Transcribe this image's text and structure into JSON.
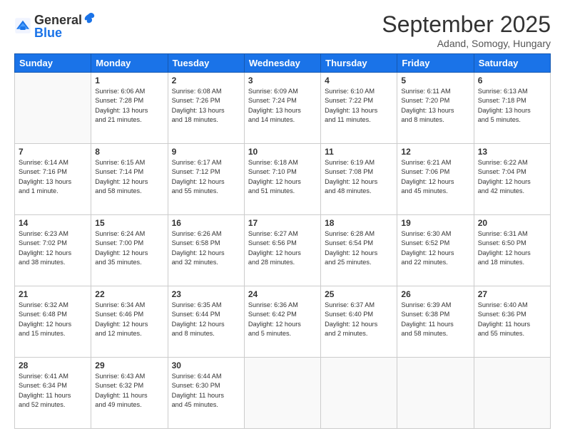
{
  "logo": {
    "general": "General",
    "blue": "Blue"
  },
  "header": {
    "month": "September 2025",
    "location": "Adand, Somogy, Hungary"
  },
  "days_of_week": [
    "Sunday",
    "Monday",
    "Tuesday",
    "Wednesday",
    "Thursday",
    "Friday",
    "Saturday"
  ],
  "weeks": [
    [
      {
        "day": "",
        "info": ""
      },
      {
        "day": "1",
        "info": "Sunrise: 6:06 AM\nSunset: 7:28 PM\nDaylight: 13 hours\nand 21 minutes."
      },
      {
        "day": "2",
        "info": "Sunrise: 6:08 AM\nSunset: 7:26 PM\nDaylight: 13 hours\nand 18 minutes."
      },
      {
        "day": "3",
        "info": "Sunrise: 6:09 AM\nSunset: 7:24 PM\nDaylight: 13 hours\nand 14 minutes."
      },
      {
        "day": "4",
        "info": "Sunrise: 6:10 AM\nSunset: 7:22 PM\nDaylight: 13 hours\nand 11 minutes."
      },
      {
        "day": "5",
        "info": "Sunrise: 6:11 AM\nSunset: 7:20 PM\nDaylight: 13 hours\nand 8 minutes."
      },
      {
        "day": "6",
        "info": "Sunrise: 6:13 AM\nSunset: 7:18 PM\nDaylight: 13 hours\nand 5 minutes."
      }
    ],
    [
      {
        "day": "7",
        "info": "Sunrise: 6:14 AM\nSunset: 7:16 PM\nDaylight: 13 hours\nand 1 minute."
      },
      {
        "day": "8",
        "info": "Sunrise: 6:15 AM\nSunset: 7:14 PM\nDaylight: 12 hours\nand 58 minutes."
      },
      {
        "day": "9",
        "info": "Sunrise: 6:17 AM\nSunset: 7:12 PM\nDaylight: 12 hours\nand 55 minutes."
      },
      {
        "day": "10",
        "info": "Sunrise: 6:18 AM\nSunset: 7:10 PM\nDaylight: 12 hours\nand 51 minutes."
      },
      {
        "day": "11",
        "info": "Sunrise: 6:19 AM\nSunset: 7:08 PM\nDaylight: 12 hours\nand 48 minutes."
      },
      {
        "day": "12",
        "info": "Sunrise: 6:21 AM\nSunset: 7:06 PM\nDaylight: 12 hours\nand 45 minutes."
      },
      {
        "day": "13",
        "info": "Sunrise: 6:22 AM\nSunset: 7:04 PM\nDaylight: 12 hours\nand 42 minutes."
      }
    ],
    [
      {
        "day": "14",
        "info": "Sunrise: 6:23 AM\nSunset: 7:02 PM\nDaylight: 12 hours\nand 38 minutes."
      },
      {
        "day": "15",
        "info": "Sunrise: 6:24 AM\nSunset: 7:00 PM\nDaylight: 12 hours\nand 35 minutes."
      },
      {
        "day": "16",
        "info": "Sunrise: 6:26 AM\nSunset: 6:58 PM\nDaylight: 12 hours\nand 32 minutes."
      },
      {
        "day": "17",
        "info": "Sunrise: 6:27 AM\nSunset: 6:56 PM\nDaylight: 12 hours\nand 28 minutes."
      },
      {
        "day": "18",
        "info": "Sunrise: 6:28 AM\nSunset: 6:54 PM\nDaylight: 12 hours\nand 25 minutes."
      },
      {
        "day": "19",
        "info": "Sunrise: 6:30 AM\nSunset: 6:52 PM\nDaylight: 12 hours\nand 22 minutes."
      },
      {
        "day": "20",
        "info": "Sunrise: 6:31 AM\nSunset: 6:50 PM\nDaylight: 12 hours\nand 18 minutes."
      }
    ],
    [
      {
        "day": "21",
        "info": "Sunrise: 6:32 AM\nSunset: 6:48 PM\nDaylight: 12 hours\nand 15 minutes."
      },
      {
        "day": "22",
        "info": "Sunrise: 6:34 AM\nSunset: 6:46 PM\nDaylight: 12 hours\nand 12 minutes."
      },
      {
        "day": "23",
        "info": "Sunrise: 6:35 AM\nSunset: 6:44 PM\nDaylight: 12 hours\nand 8 minutes."
      },
      {
        "day": "24",
        "info": "Sunrise: 6:36 AM\nSunset: 6:42 PM\nDaylight: 12 hours\nand 5 minutes."
      },
      {
        "day": "25",
        "info": "Sunrise: 6:37 AM\nSunset: 6:40 PM\nDaylight: 12 hours\nand 2 minutes."
      },
      {
        "day": "26",
        "info": "Sunrise: 6:39 AM\nSunset: 6:38 PM\nDaylight: 11 hours\nand 58 minutes."
      },
      {
        "day": "27",
        "info": "Sunrise: 6:40 AM\nSunset: 6:36 PM\nDaylight: 11 hours\nand 55 minutes."
      }
    ],
    [
      {
        "day": "28",
        "info": "Sunrise: 6:41 AM\nSunset: 6:34 PM\nDaylight: 11 hours\nand 52 minutes."
      },
      {
        "day": "29",
        "info": "Sunrise: 6:43 AM\nSunset: 6:32 PM\nDaylight: 11 hours\nand 49 minutes."
      },
      {
        "day": "30",
        "info": "Sunrise: 6:44 AM\nSunset: 6:30 PM\nDaylight: 11 hours\nand 45 minutes."
      },
      {
        "day": "",
        "info": ""
      },
      {
        "day": "",
        "info": ""
      },
      {
        "day": "",
        "info": ""
      },
      {
        "day": "",
        "info": ""
      }
    ]
  ]
}
